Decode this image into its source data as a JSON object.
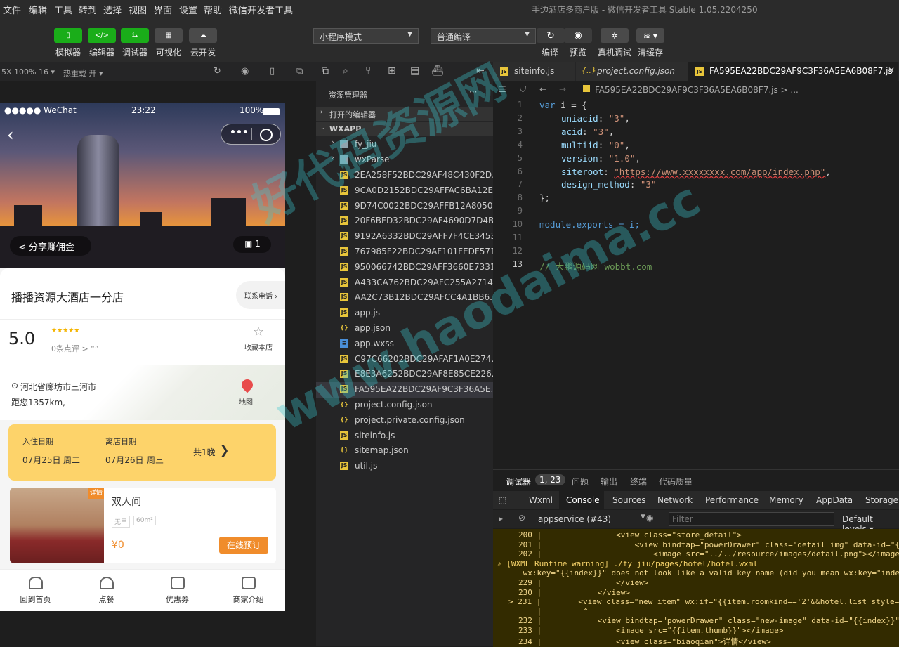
{
  "menubar": {
    "items": [
      "文件",
      "编辑",
      "工具",
      "转到",
      "选择",
      "视图",
      "界面",
      "设置",
      "帮助",
      "微信开发者工具"
    ],
    "title": "手边酒店多商户版 - 微信开发者工具 Stable 1.05.2204250"
  },
  "toolbar": {
    "buttons": [
      "模拟器",
      "编辑器",
      "调试器",
      "可视化",
      "云开发"
    ],
    "mode_select": "小程序模式",
    "compile_select": "普通编译",
    "actions": [
      "编译",
      "预览",
      "真机调试",
      "清缓存"
    ]
  },
  "subbar": {
    "zoom": "5X 100% 16 ▾",
    "hotreload": "热重载 开 ▾"
  },
  "phone": {
    "status": {
      "carrier": "●●●●● WeChat",
      "time": "23:22",
      "battery": "100%"
    },
    "share_label": "分享赚佣金",
    "photo_count": "1",
    "hotel_name": "播播资源大酒店一分店",
    "contact_label": "联系电话",
    "rating": "5.0",
    "stars": "★★★★★",
    "reviews": "0条点评 >  “”",
    "favorite_label": "收藏本店",
    "address": "河北省廊坊市三河市",
    "distance": "距您1357km,",
    "map_label": "地图",
    "checkin_label": "入住日期",
    "checkin_date": "07月25日",
    "checkin_day": "周二",
    "checkout_label": "离店日期",
    "checkout_date": "07月26日",
    "checkout_day": "周三",
    "nights": "共1晚",
    "room": {
      "badge": "详情",
      "name": "双人间",
      "tag1": "无早",
      "tag2": "60m²",
      "price": "¥0",
      "book_label": "在线预订"
    },
    "nav": [
      "回到首页",
      "点餐",
      "优惠券",
      "商家介绍"
    ]
  },
  "explorer": {
    "header": "资源管理器",
    "open_editors": "打开的编辑器",
    "root": "WXAPP",
    "folders": [
      "fy_jiu",
      "wxParse"
    ],
    "files": [
      {
        "name": "2EA258F52BDC29AF48C430F2D...",
        "type": "js"
      },
      {
        "name": "9CA0D2152BDC29AFFAC6BA12E...",
        "type": "js"
      },
      {
        "name": "9D74C0022BDC29AFFB12A8050...",
        "type": "js"
      },
      {
        "name": "20F6BFD32BDC29AF4690D7D4B...",
        "type": "js"
      },
      {
        "name": "9192A6332BDC29AFF7F4CE3453...",
        "type": "js"
      },
      {
        "name": "767985F22BDC29AF101FEDF571...",
        "type": "js"
      },
      {
        "name": "950066742BDC29AFF3660E7331...",
        "type": "js"
      },
      {
        "name": "A433CA762BDC29AFC255A2714...",
        "type": "js"
      },
      {
        "name": "AA2C73B12BDC29AFCC4A1BB6...",
        "type": "js"
      },
      {
        "name": "app.js",
        "type": "js"
      },
      {
        "name": "app.json",
        "type": "json"
      },
      {
        "name": "app.wxss",
        "type": "wxss"
      },
      {
        "name": "C97C66202BDC29AFAF1A0E274...",
        "type": "js"
      },
      {
        "name": "E8E3A6252BDC29AF8E85CE226...",
        "type": "js"
      },
      {
        "name": "FA595EA22BDC29AF9C3F36A5E...",
        "type": "js"
      },
      {
        "name": "project.config.json",
        "type": "json"
      },
      {
        "name": "project.private.config.json",
        "type": "json"
      },
      {
        "name": "siteinfo.js",
        "type": "js"
      },
      {
        "name": "sitemap.json",
        "type": "json"
      },
      {
        "name": "util.js",
        "type": "js"
      }
    ]
  },
  "editor": {
    "tabs": [
      "siteinfo.js",
      "project.config.json",
      "FA595EA22BDC29AF9C3F36A5EA6B08F7.js"
    ],
    "breadcrumb": "FA595EA22BDC29AF9C3F36A5EA6B08F7.js > ...",
    "lines": [
      {
        "n": "1",
        "kw": "var",
        "rest": " i = {"
      },
      {
        "n": "2",
        "key": "uniacid",
        "val": "\"3\""
      },
      {
        "n": "3",
        "key": "acid",
        "val": "\"3\""
      },
      {
        "n": "4",
        "key": "multiid",
        "val": "\"0\""
      },
      {
        "n": "5",
        "key": "version",
        "val": "\"1.0\""
      },
      {
        "n": "6",
        "key": "siteroot",
        "val": "\"https://www.xxxxxxxx.com/app/index.php\""
      },
      {
        "n": "7",
        "key": "design_method",
        "val": "\"3\""
      },
      {
        "n": "8",
        "text": "};"
      },
      {
        "n": "9",
        "text": ""
      },
      {
        "n": "10",
        "text": "module.exports = i;"
      },
      {
        "n": "11",
        "text": ""
      },
      {
        "n": "12",
        "text": ""
      },
      {
        "n": "13",
        "comment": "// 大鹏源码网 wobbt.com"
      }
    ]
  },
  "debug": {
    "tabs": [
      "调试器",
      "1, 23",
      "问题",
      "输出",
      "终端",
      "代码质量"
    ],
    "panels": [
      "Wxml",
      "Console",
      "Sources",
      "Network",
      "Performance",
      "Memory",
      "AppData",
      "Storage"
    ],
    "context": "appservice (#43)",
    "filter_placeholder": "Filter",
    "levels": "Default levels ▾",
    "console_lines": [
      "200 |                <view class=\"store_detail\">",
      "201 |                    <view bindtap=\"powerDrawer\" class=\"detail_img\" data-id=\"{",
      "202 |                        <image src=\"../../resource/images/detail.png\"></image",
      "⚠ [WXML Runtime warning] ./fy_jiu/pages/hotel/hotel.wxml",
      " wx:key=\"{{index}}\" does not look like a valid key name (did you mean wx:key=\"index\"",
      "229 |                </view>",
      "230 |            </view>",
      "> 231 |        <view class=\"new_item\" wx:if=\"{{item.roomkind=='2'&&hotel.list_style=",
      "    |         ^",
      "232 |            <view bindtap=\"powerDrawer\" class=\"new-image\" data-id=\"{{index}}\"",
      "233 |                <image src=\"{{item.thumb}}\"></image>",
      "234 |                <view class=\"biaoqian\">详情</view>"
    ]
  },
  "watermark": {
    "line1": "好代码资源网",
    "line2": "www.haodaima.cc"
  },
  "colors": {
    "accent": "#1aad19",
    "orange": "#f08c2b",
    "yellow": "#fdd36a"
  }
}
